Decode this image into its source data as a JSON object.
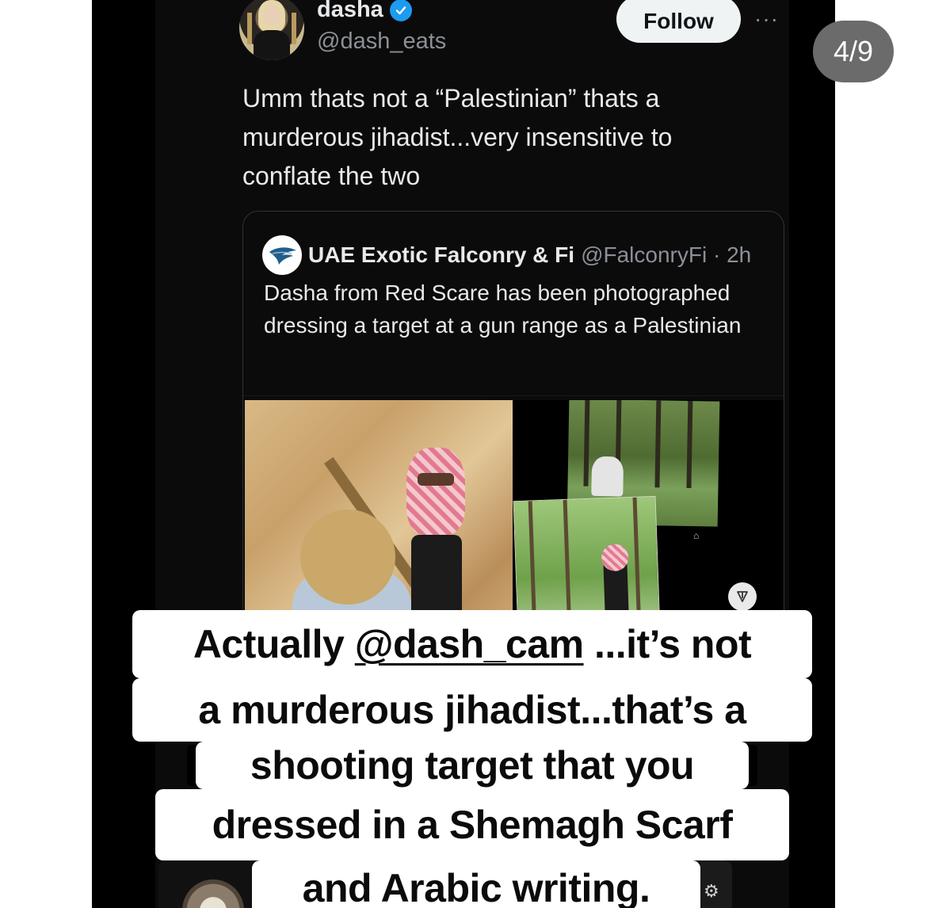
{
  "tweet": {
    "display_name": "dasha",
    "handle": "@dash_eats",
    "follow_label": "Follow",
    "more_label": "···",
    "text": "Umm thats not a “Palestinian” thats a murderous jihadist...very insensitive to conflate the two"
  },
  "quote": {
    "display_name": "UAE Exotic Falconry & Fi",
    "meta": "@FalconryFi · 2h",
    "text": "Dasha from Red Scare has been photographed dressing a target at a gun range as a Palestinian"
  },
  "story": {
    "counter": "4/9"
  },
  "caption": {
    "line1_prefix": "Actually ",
    "line1_mention": "@dash_cam",
    "line1_suffix": " ...it’s not",
    "line2": "a murderous jihadist...that’s a",
    "line3": "shooting target that you",
    "line4": "dressed in a Shemagh Scarf",
    "line5": "and Arabic writing."
  },
  "icons": {
    "verified": "verified-badge-icon",
    "more": "more-options-icon",
    "share": "share-icon",
    "quote_avatar": "falcon-logo-icon"
  },
  "colors": {
    "accent": "#1d9bf0",
    "background": "#0b0b0c",
    "text_primary": "#e7e9ea",
    "text_secondary": "#8b9096"
  }
}
